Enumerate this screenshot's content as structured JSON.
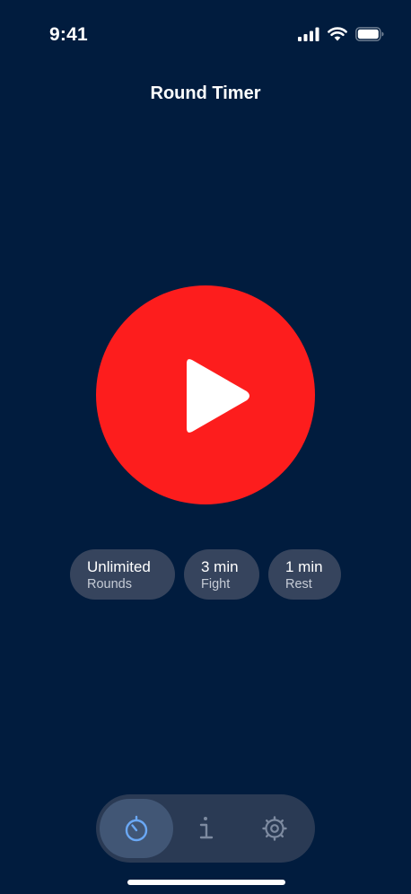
{
  "status_bar": {
    "time": "9:41",
    "icons": [
      "signal-icon",
      "wifi-icon",
      "battery-icon"
    ]
  },
  "header": {
    "title": "Round Timer"
  },
  "play_button": {
    "icon": "play-icon",
    "color": "#fd1d1d"
  },
  "settings_chips": [
    {
      "value": "Unlimited",
      "label": "Rounds"
    },
    {
      "value": "3 min",
      "label": "Fight"
    },
    {
      "value": "1 min",
      "label": "Rest"
    }
  ],
  "tab_bar": {
    "tabs": [
      {
        "icon": "timer-icon",
        "selected": true
      },
      {
        "icon": "info-icon",
        "selected": false
      },
      {
        "icon": "gear-icon",
        "selected": false
      }
    ]
  },
  "colors": {
    "background": "#011c3e",
    "accent": "#fd1d1d",
    "chip": "#36445d",
    "tab_bar": "#2a3a54",
    "tab_selected": "#415675",
    "selected_icon": "#6aa8f5",
    "icon_muted": "#7d8aa0"
  }
}
